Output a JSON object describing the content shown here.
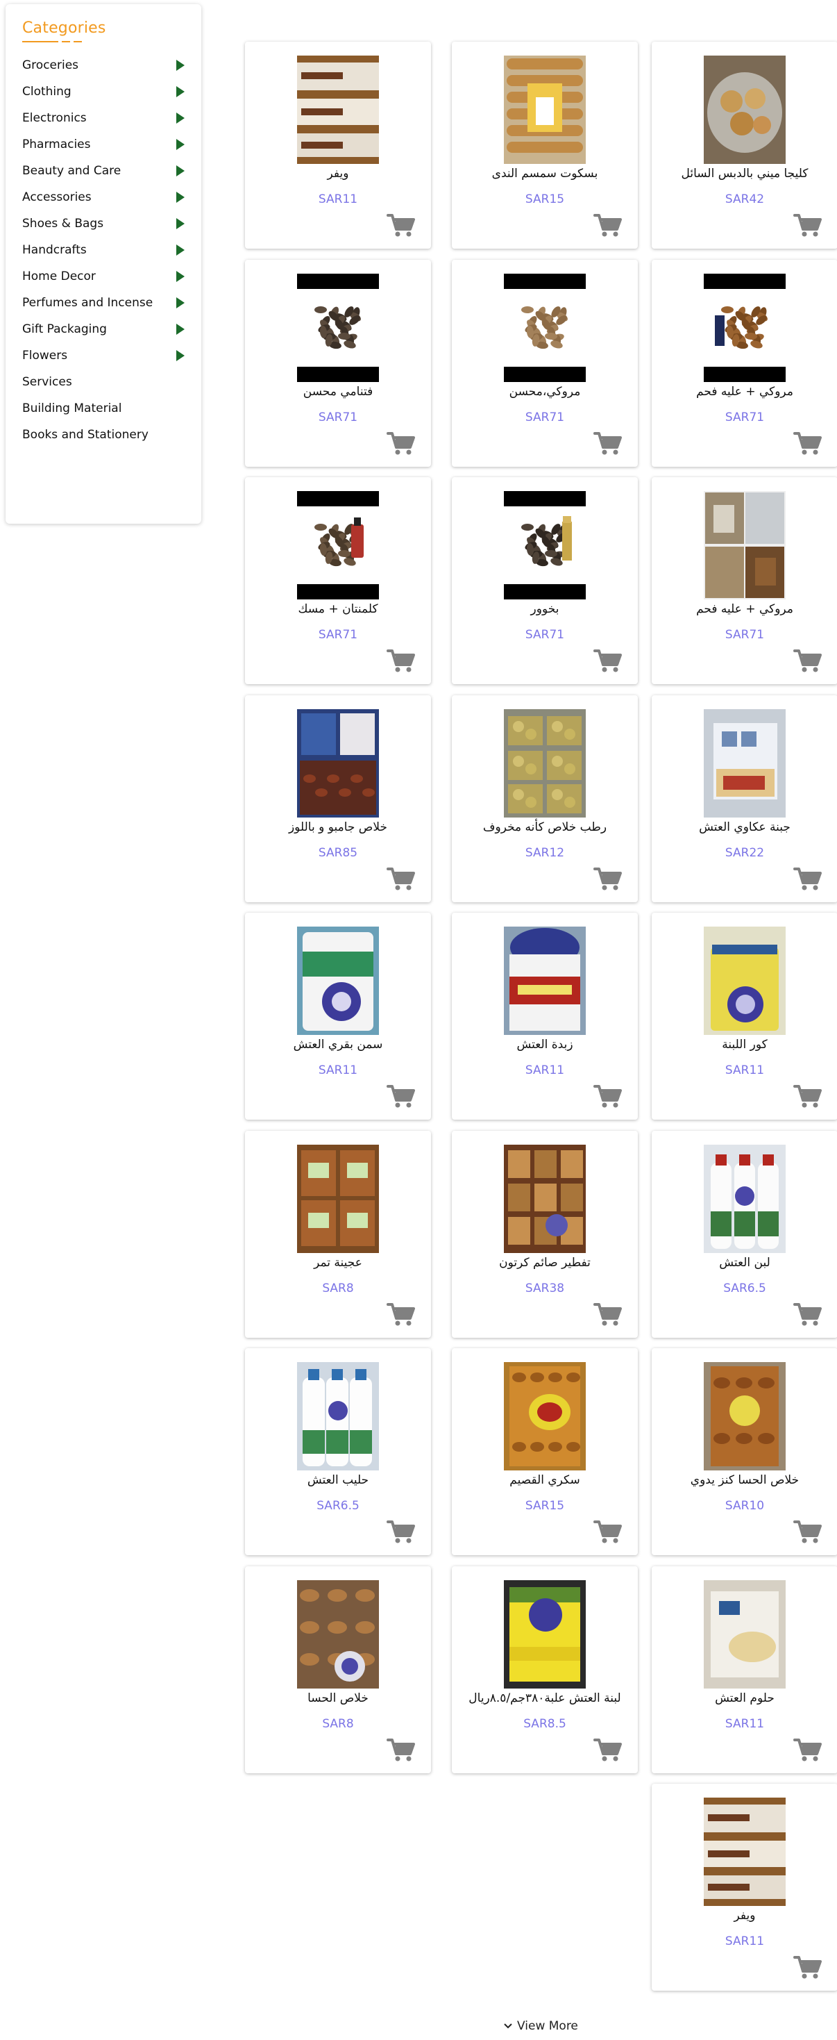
{
  "sidebar": {
    "title": "Categories",
    "items": [
      {
        "label": "Groceries",
        "arrow": true
      },
      {
        "label": "Clothing",
        "arrow": true
      },
      {
        "label": "Electronics",
        "arrow": true
      },
      {
        "label": "Pharmacies",
        "arrow": true
      },
      {
        "label": "Beauty and Care",
        "arrow": true
      },
      {
        "label": "Accessories",
        "arrow": true
      },
      {
        "label": "Shoes & Bags",
        "arrow": true
      },
      {
        "label": "Handcrafts",
        "arrow": true
      },
      {
        "label": "Home Decor",
        "arrow": true
      },
      {
        "label": "Perfumes and Incense",
        "arrow": true
      },
      {
        "label": "Gift Packaging",
        "arrow": true
      },
      {
        "label": "Flowers",
        "arrow": true
      },
      {
        "label": "Services",
        "arrow": false
      },
      {
        "label": "Building Material",
        "arrow": false
      },
      {
        "label": "Books and Stationery",
        "arrow": false
      }
    ]
  },
  "products": [
    {
      "name": "كليجا ميني بالدبس السائل",
      "price": "SAR42",
      "image": "dessert-plate"
    },
    {
      "name": "بسكوت سمسم الندى",
      "price": "SAR15",
      "image": "biscuits-pack"
    },
    {
      "name": "ويفر",
      "price": "SAR11",
      "image": "wafer-boxes"
    },
    {
      "name": "مروكي + عليه فحم",
      "price": "SAR71",
      "image": "dates-with-box"
    },
    {
      "name": "مروكي،محسن",
      "price": "SAR71",
      "image": "dates-pile-light"
    },
    {
      "name": "فتنامي محسن",
      "price": "SAR71",
      "image": "dates-pile-dark"
    },
    {
      "name": "مروكي + عليه فحم",
      "price": "SAR71",
      "image": "dates-collage"
    },
    {
      "name": "بخوور",
      "price": "SAR71",
      "image": "incense-with-bottle"
    },
    {
      "name": "كلمنتان + مسك",
      "price": "SAR71",
      "image": "incense-with-oil"
    },
    {
      "name": "جبنة عكاوي العتش",
      "price": "SAR22",
      "image": "cheese-block"
    },
    {
      "name": "رطب خلاص كأنه مخروف",
      "price": "SAR12",
      "image": "ruttab-trays"
    },
    {
      "name": "خلاص جامبو و باللوز",
      "price": "SAR85",
      "image": "dates-boxes-blue"
    },
    {
      "name": "كور اللبنة",
      "price": "SAR11",
      "image": "labneh-jar"
    },
    {
      "name": "زبدة العتش",
      "price": "SAR11",
      "image": "butter-tub"
    },
    {
      "name": "سمن بقري العتش",
      "price": "SAR11",
      "image": "ghee-tub"
    },
    {
      "name": "لبن العتش",
      "price": "SAR6.5",
      "image": "laban-bottles"
    },
    {
      "name": "تفطير صائم كرتون",
      "price": "SAR38",
      "image": "iftar-box"
    },
    {
      "name": "عجينة تمر",
      "price": "SAR8",
      "image": "date-paste"
    },
    {
      "name": "خلاص الحسا كنز يدوي",
      "price": "SAR10",
      "image": "dates-bag"
    },
    {
      "name": "سكري القصيم",
      "price": "SAR15",
      "image": "sukkari-bag"
    },
    {
      "name": "حليب العتش",
      "price": "SAR6.5",
      "image": "milk-bottles"
    },
    {
      "name": "حلوم العتش",
      "price": "SAR11",
      "image": "halloumi-pack"
    },
    {
      "name": "لبنة العتش علبة٣٨٠جم/٨.٥ريال",
      "price": "SAR8.5",
      "image": "labneh-tubs"
    },
    {
      "name": "خلاص الحسا",
      "price": "SAR8",
      "image": "dates-tray"
    },
    {
      "name": "ويفر",
      "price": "SAR11",
      "image": "wafer-boxes"
    }
  ],
  "view_more": "View More",
  "colors": {
    "accent": "#f29a1f",
    "price": "#7b74e6",
    "arrow": "#1b6b2a",
    "cart": "#808080"
  }
}
